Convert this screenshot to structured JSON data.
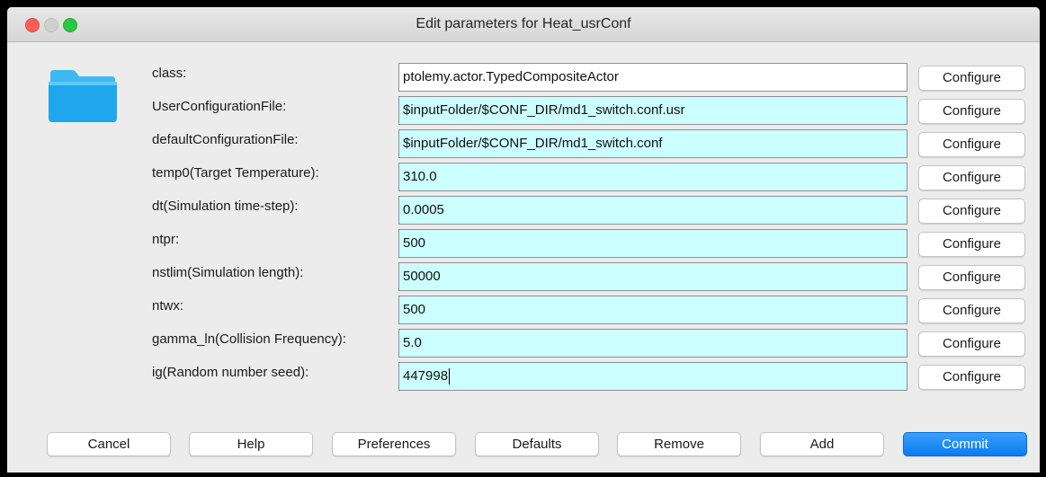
{
  "window": {
    "title": "Edit parameters for Heat_usrConf",
    "icon": "folder-icon"
  },
  "parameters": [
    {
      "label": "class:",
      "value": "ptolemy.actor.TypedCompositeActor",
      "button": "Configure"
    },
    {
      "label": "UserConfigurationFile:",
      "value": "$inputFolder/$CONF_DIR/md1_switch.conf.usr",
      "button": "Configure"
    },
    {
      "label": "defaultConfigurationFile:",
      "value": "$inputFolder/$CONF_DIR/md1_switch.conf",
      "button": "Configure"
    },
    {
      "label": "temp0(Target Temperature):",
      "value": "310.0",
      "button": "Configure"
    },
    {
      "label": "dt(Simulation time-step):",
      "value": "0.0005",
      "button": "Configure"
    },
    {
      "label": "ntpr:",
      "value": "500",
      "button": "Configure"
    },
    {
      "label": "nstlim(Simulation length):",
      "value": "50000",
      "button": "Configure"
    },
    {
      "label": "ntwx:",
      "value": "500",
      "button": "Configure"
    },
    {
      "label": "gamma_ln(Collision Frequency):",
      "value": "5.0",
      "button": "Configure"
    },
    {
      "label": "ig(Random number seed):",
      "value": "447998",
      "button": "Configure"
    }
  ],
  "footer": {
    "cancel": "Cancel",
    "help": "Help",
    "preferences": "Preferences",
    "defaults": "Defaults",
    "remove": "Remove",
    "add": "Add",
    "commit": "Commit"
  },
  "colors": {
    "field_bg": "#ccffff",
    "commit_accent": "#0a7cf0"
  }
}
